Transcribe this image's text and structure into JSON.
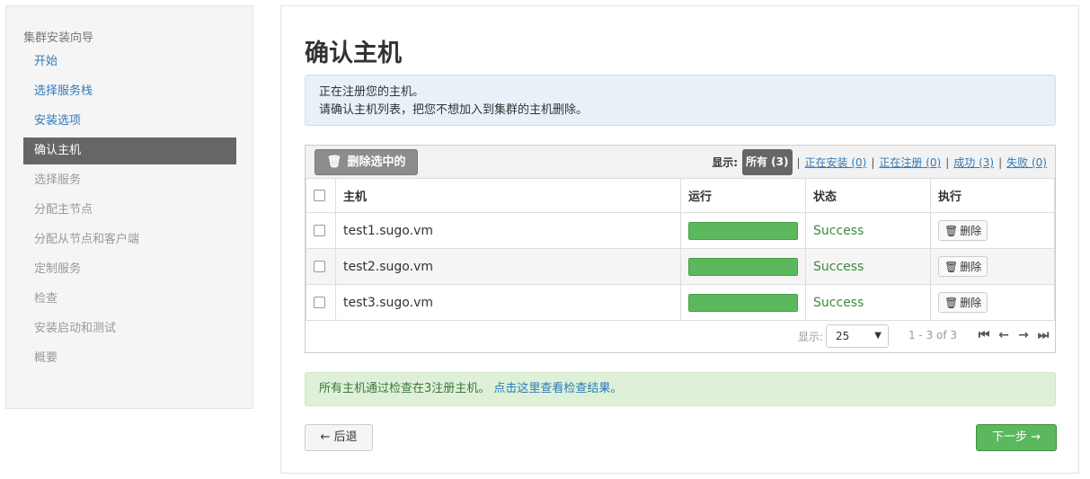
{
  "sidebar": {
    "header": "集群安装向导",
    "items": [
      {
        "label": "开始",
        "state": "done"
      },
      {
        "label": "选择服务栈",
        "state": "done"
      },
      {
        "label": "安装选项",
        "state": "done"
      },
      {
        "label": "确认主机",
        "state": "active"
      },
      {
        "label": "选择服务",
        "state": "todo"
      },
      {
        "label": "分配主节点",
        "state": "todo"
      },
      {
        "label": "分配从节点和客户端",
        "state": "todo"
      },
      {
        "label": "定制服务",
        "state": "todo"
      },
      {
        "label": "检查",
        "state": "todo"
      },
      {
        "label": "安装启动和测试",
        "state": "todo"
      },
      {
        "label": "概要",
        "state": "todo"
      }
    ]
  },
  "main": {
    "title": "确认主机",
    "info_line1": "正在注册您的主机。",
    "info_line2": "请确认主机列表，把您不想加入到集群的主机删除。",
    "toolbar": {
      "delete_selected": "删除选中的",
      "show_label": "显示:",
      "filter_all": "所有 (3)",
      "filter_installing": "正在安装 (0)",
      "filter_registering": "正在注册 (0)",
      "filter_success": "成功 (3)",
      "filter_failed": "失败 (0)",
      "separator": "|"
    },
    "table": {
      "headers": {
        "host": "主机",
        "progress": "运行",
        "status": "状态",
        "action": "执行"
      },
      "rows": [
        {
          "host": "test1.sugo.vm",
          "progress": 1.0,
          "status": "Success",
          "action": "删除"
        },
        {
          "host": "test2.sugo.vm",
          "progress": 1.0,
          "status": "Success",
          "action": "删除"
        },
        {
          "host": "test3.sugo.vm",
          "progress": 1.0,
          "status": "Success",
          "action": "删除"
        }
      ]
    },
    "pager": {
      "show_label": "显示:",
      "page_size": "25",
      "range": "1 - 3 of 3"
    },
    "success_text": "所有主机通过检查在3注册主机。",
    "success_link": "点击这里查看检查结果。",
    "back_button": "← 后退",
    "next_button": "下一步 →"
  },
  "colors": {
    "active_nav_bg": "#666666",
    "link": "#337ab7",
    "success": "#5cb85c",
    "info_bg": "#e7f1f7",
    "success_bg": "#dff0d8"
  }
}
